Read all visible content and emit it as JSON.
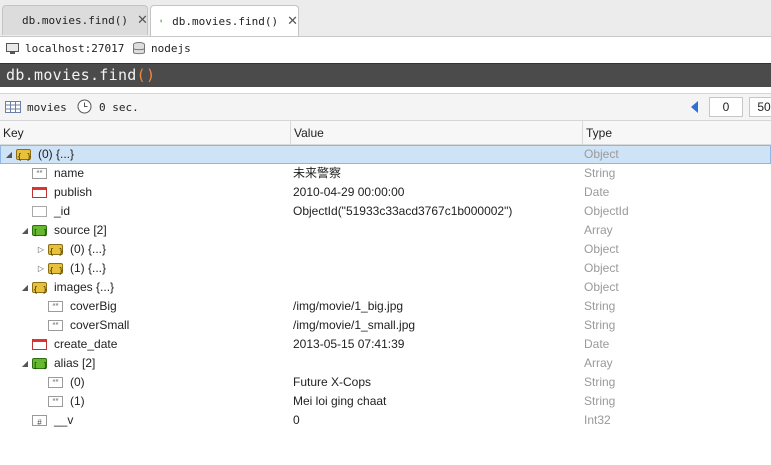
{
  "tabs": [
    {
      "label": "db.movies.find()",
      "close": "✕"
    },
    {
      "label": "db.movies.find()",
      "close": "✕"
    }
  ],
  "connection": {
    "host": "localhost:27017",
    "database": "nodejs"
  },
  "query": {
    "text": "db.movies.find",
    "parens": "()"
  },
  "results": {
    "collection": "movies",
    "time": "0 sec.",
    "page_start": "0",
    "page_size": "50"
  },
  "columns": {
    "key": "Key",
    "value": "Value",
    "type": "Type"
  },
  "rows": [
    {
      "key": "(0)  {...}",
      "value": "",
      "type": "Object",
      "icon": "object-icon",
      "level": 0,
      "expand": "open",
      "selected": true
    },
    {
      "key": "name",
      "value": "未来警察",
      "type": "String",
      "icon": "string-icon",
      "level": 1,
      "expand": "none"
    },
    {
      "key": "publish",
      "value": "2010-04-29 00:00:00",
      "type": "Date",
      "icon": "date-icon",
      "level": 1,
      "expand": "none"
    },
    {
      "key": "_id",
      "value": "ObjectId(\"51933c33acd3767c1b000002\")",
      "type": "ObjectId",
      "icon": "objectid-icon",
      "level": 1,
      "expand": "none"
    },
    {
      "key": "source [2]",
      "value": "",
      "type": "Array",
      "icon": "array-icon",
      "level": 1,
      "expand": "open"
    },
    {
      "key": "(0)  {...}",
      "value": "",
      "type": "Object",
      "icon": "object-icon",
      "level": 2,
      "expand": "closed"
    },
    {
      "key": "(1)  {...}",
      "value": "",
      "type": "Object",
      "icon": "object-icon",
      "level": 2,
      "expand": "closed"
    },
    {
      "key": "images  {...}",
      "value": "",
      "type": "Object",
      "icon": "object-icon",
      "level": 1,
      "expand": "open"
    },
    {
      "key": "coverBig",
      "value": "/img/movie/1_big.jpg",
      "type": "String",
      "icon": "string-icon",
      "level": 2,
      "expand": "none"
    },
    {
      "key": "coverSmall",
      "value": "/img/movie/1_small.jpg",
      "type": "String",
      "icon": "string-icon",
      "level": 2,
      "expand": "none"
    },
    {
      "key": "create_date",
      "value": "2013-05-15 07:41:39",
      "type": "Date",
      "icon": "date-icon",
      "level": 1,
      "expand": "none"
    },
    {
      "key": "alias [2]",
      "value": "",
      "type": "Array",
      "icon": "array-icon",
      "level": 1,
      "expand": "open"
    },
    {
      "key": "(0)",
      "value": "Future X-Cops",
      "type": "String",
      "icon": "string-icon",
      "level": 2,
      "expand": "none"
    },
    {
      "key": "(1)",
      "value": "Mei loi ging chaat",
      "type": "String",
      "icon": "string-icon",
      "level": 2,
      "expand": "none"
    },
    {
      "key": "__v",
      "value": "0",
      "type": "Int32",
      "icon": "int-icon",
      "level": 1,
      "expand": "none"
    }
  ]
}
